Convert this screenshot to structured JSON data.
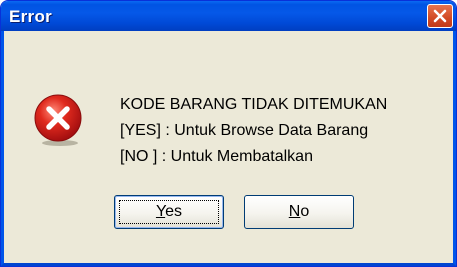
{
  "window": {
    "title": "Error",
    "close_icon": "close-icon"
  },
  "dialog": {
    "icon": "error-icon",
    "message_lines": [
      "KODE BARANG TIDAK DITEMUKAN",
      "[YES] : Untuk Browse Data Barang",
      "[NO ] : Untuk Membatalkan"
    ]
  },
  "buttons": {
    "yes": {
      "accel": "Y",
      "rest": "es"
    },
    "no": {
      "accel": "N",
      "rest": "o"
    }
  },
  "colors": {
    "titlebar": "#0054e3",
    "window_bg": "#ece9d8",
    "close_red": "#d24a24",
    "error_red": "#c4161a"
  }
}
